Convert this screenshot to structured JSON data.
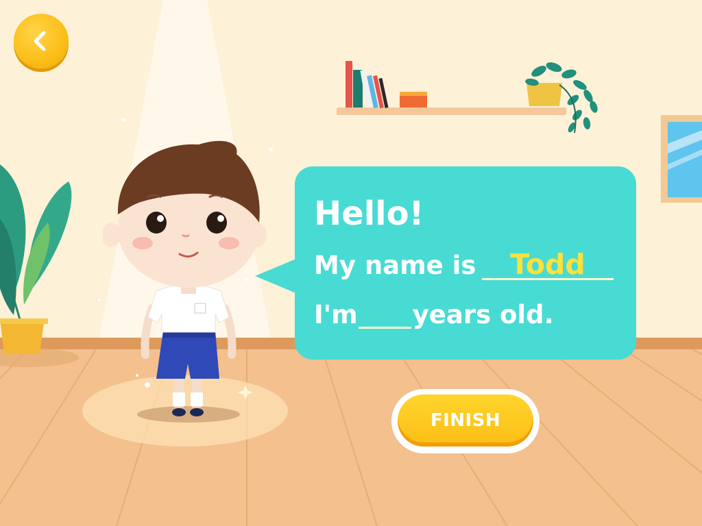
{
  "toolbar": {
    "back_icon": "chevron-left-icon"
  },
  "speech": {
    "greeting": "Hello!",
    "name_prefix": "My name is",
    "name_value": "Todd",
    "age_prefix": "I'm",
    "age_value": "",
    "age_suffix": "years old."
  },
  "finish_button": {
    "label": "FINISH"
  },
  "colors": {
    "bubble": "#48dbd3",
    "name_text": "#ffe13a",
    "button": "#fbbe16",
    "wall": "#fdf1d8",
    "floor": "#f3c08e"
  }
}
